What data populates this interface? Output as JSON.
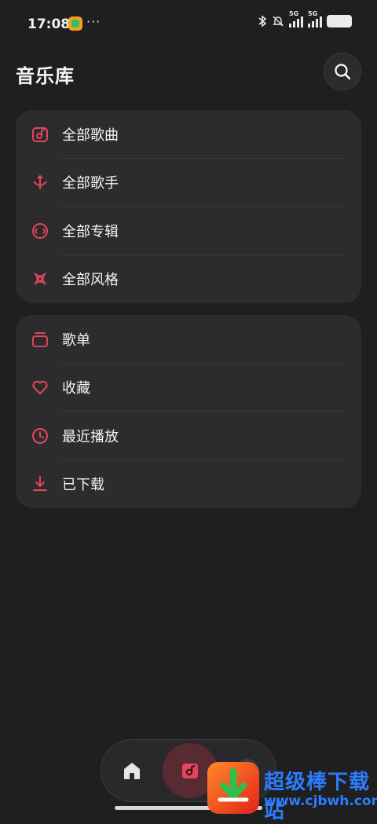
{
  "status_bar": {
    "time": "17:08",
    "dots": "···",
    "network_a": "5G",
    "network_b": "5G",
    "battery": "81"
  },
  "header": {
    "title": "音乐库",
    "search_icon": "search-icon"
  },
  "library_sections": [
    {
      "label": "全部歌曲",
      "icon": "song-icon"
    },
    {
      "label": "全部歌手",
      "icon": "artist-icon"
    },
    {
      "label": "全部专辑",
      "icon": "album-icon"
    },
    {
      "label": "全部风格",
      "icon": "genre-icon"
    }
  ],
  "my_collection": [
    {
      "label": "歌单",
      "icon": "playlist-icon"
    },
    {
      "label": "收藏",
      "icon": "heart-icon"
    },
    {
      "label": "最近播放",
      "icon": "clock-icon"
    },
    {
      "label": "已下载",
      "icon": "download-icon"
    }
  ],
  "bottom_nav": {
    "items": [
      "home-icon",
      "music-library-icon"
    ],
    "active": "music-library-icon"
  },
  "watermark": {
    "title": "超级棒下载站",
    "url": "www.cjbwh.com"
  },
  "colors": {
    "accent": "#e2455c",
    "background": "#1f1f21",
    "card": "#2c2c2e"
  }
}
